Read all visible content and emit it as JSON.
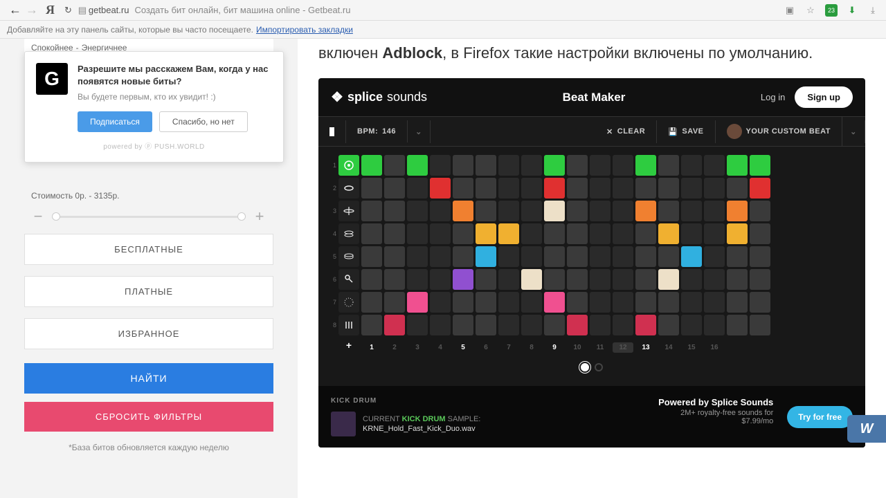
{
  "browser": {
    "url": "getbeat.ru",
    "title": "Создать бит онлайн, бит машина online - Getbeat.ru",
    "bookmark_hint": "Добавляйте на эту панель сайты, которые вы часто посещаете.",
    "import_link": "Импортировать закладки",
    "ext_badge": "23"
  },
  "notif": {
    "logo": "G",
    "title": "Разрешите мы расскажем Вам, когда у нас появятся новые биты?",
    "subtitle": "Вы будете первым, кто их увидит! :)",
    "subscribe": "Подписаться",
    "decline": "Спасибо, но нет",
    "powered": "powered by ⓟ PUSH.WORLD"
  },
  "filters": {
    "mood_left": "Спокойнее",
    "mood_right": "Энергичнее",
    "price_label": "Стоимость 0р. - 3135р.",
    "free": "БЕСПЛАТНЫЕ",
    "paid": "ПЛАТНЫЕ",
    "fav": "ИЗБРАННОЕ",
    "find": "НАЙТИ",
    "reset": "СБРОСИТЬ ФИЛЬТРЫ",
    "footnote": "*База битов обновляется каждую неделю"
  },
  "article": {
    "text_before": "включен ",
    "bold": "Adblock",
    "text_after": ", в Firefox такие настройки включены по умолчанию."
  },
  "beatmaker": {
    "brand_bold": "splice",
    "brand_light": "sounds",
    "title": "Beat Maker",
    "login": "Log in",
    "signup": "Sign up",
    "bpm_label": "BPM:",
    "bpm_value": "146",
    "clear": "CLEAR",
    "save": "SAVE",
    "beat_name": "YOUR CUSTOM BEAT",
    "steps": [
      "1",
      "2",
      "3",
      "4",
      "5",
      "6",
      "7",
      "8",
      "9",
      "10",
      "11",
      "12",
      "13",
      "14",
      "15",
      "16"
    ],
    "step_active": [
      true,
      false,
      false,
      false,
      true,
      false,
      false,
      false,
      true,
      false,
      false,
      false,
      true,
      false,
      false,
      false
    ],
    "step_selected": 12,
    "grid": [
      {
        "color": "#2ecc40",
        "cells": [
          1,
          0,
          1,
          0,
          0,
          0,
          0,
          0,
          1,
          0,
          0,
          0,
          1,
          0,
          0,
          0,
          1,
          1
        ]
      },
      {
        "color": "#e03030",
        "cells": [
          0,
          0,
          0,
          1,
          0,
          0,
          0,
          0,
          1,
          0,
          0,
          0,
          0,
          0,
          0,
          0,
          0,
          1
        ]
      },
      {
        "color": "#f08030",
        "cells": [
          0,
          0,
          0,
          0,
          1,
          0,
          0,
          0,
          2,
          0,
          0,
          0,
          1,
          0,
          0,
          0,
          1,
          0
        ]
      },
      {
        "color": "#f0b030",
        "cells": [
          0,
          0,
          0,
          0,
          0,
          1,
          1,
          0,
          0,
          0,
          0,
          0,
          0,
          1,
          0,
          0,
          1,
          0
        ]
      },
      {
        "color": "#30b0e0",
        "cells": [
          0,
          0,
          0,
          0,
          0,
          1,
          0,
          0,
          0,
          0,
          0,
          0,
          0,
          0,
          1,
          0,
          0,
          0
        ]
      },
      {
        "color": "#9050d0",
        "cells": [
          0,
          0,
          0,
          0,
          1,
          0,
          0,
          2,
          0,
          0,
          0,
          0,
          0,
          2,
          0,
          0,
          0,
          0
        ]
      },
      {
        "color": "#f05090",
        "cells": [
          0,
          0,
          1,
          0,
          0,
          0,
          0,
          0,
          1,
          0,
          0,
          0,
          0,
          0,
          0,
          0,
          0,
          0
        ]
      },
      {
        "color": "#d03050",
        "cells": [
          0,
          1,
          0,
          0,
          0,
          0,
          0,
          0,
          0,
          1,
          0,
          0,
          1,
          0,
          0,
          0,
          0,
          0
        ]
      }
    ],
    "footer": {
      "track": "KICK DRUM",
      "sample_prefix": "CURRENT ",
      "sample_highlight": "KICK DRUM",
      "sample_suffix": " SAMPLE:",
      "sample_file": "KRNE_Hold_Fast_Kick_Duo.wav",
      "promo1": "Powered by Splice Sounds",
      "promo2": "2M+ royalty-free sounds for",
      "promo3": "$7.99/mo",
      "try": "Try for free"
    }
  },
  "vk": "W"
}
